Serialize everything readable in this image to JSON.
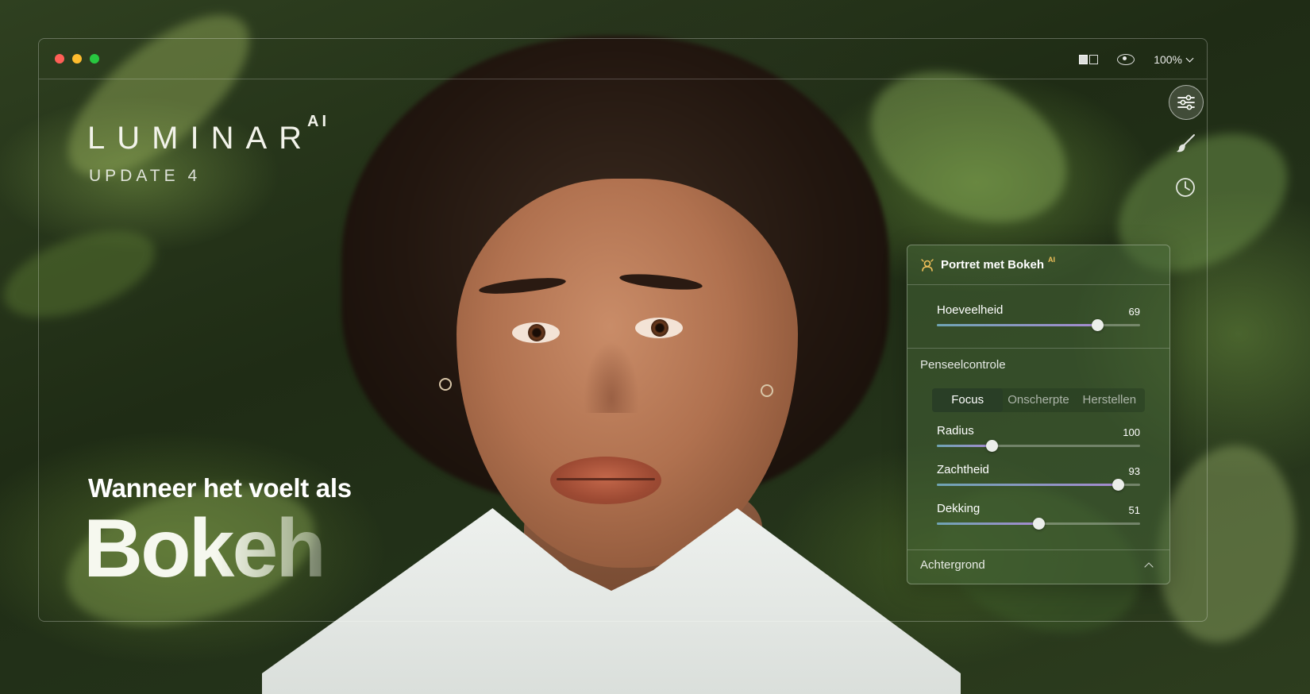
{
  "titlebar": {
    "zoom_label": "100%"
  },
  "branding": {
    "app_name": "LUMINAR",
    "ai_superscript": "AI",
    "update_label": "UPDATE 4",
    "tagline": "Wanneer het voelt als",
    "headline": "Bokeh"
  },
  "toolbar": {
    "tools": [
      {
        "icon": "sliders-icon",
        "active": true
      },
      {
        "icon": "brush-icon",
        "active": false
      },
      {
        "icon": "history-clock-icon",
        "active": false
      }
    ]
  },
  "panel": {
    "title": "Portret met Bokeh",
    "title_badge": "AI",
    "amount": {
      "label": "Hoeveelheid",
      "value": "69",
      "fraction": 0.79
    },
    "brush_section_label": "Penseelcontrole",
    "modes": [
      "Focus",
      "Onscherpte",
      "Herstellen"
    ],
    "active_mode": "Focus",
    "radius": {
      "label": "Radius",
      "value": "100",
      "fraction": 0.27
    },
    "softness": {
      "label": "Zachtheid",
      "value": "93",
      "fraction": 0.89
    },
    "opacity": {
      "label": "Dekking",
      "value": "51",
      "fraction": 0.5
    },
    "background_section_label": "Achtergrond"
  },
  "colors": {
    "accent_gradient_start": "#6fa4b4",
    "accent_gradient_end": "#a58bd0",
    "ai_badge": "#f0c05a"
  }
}
